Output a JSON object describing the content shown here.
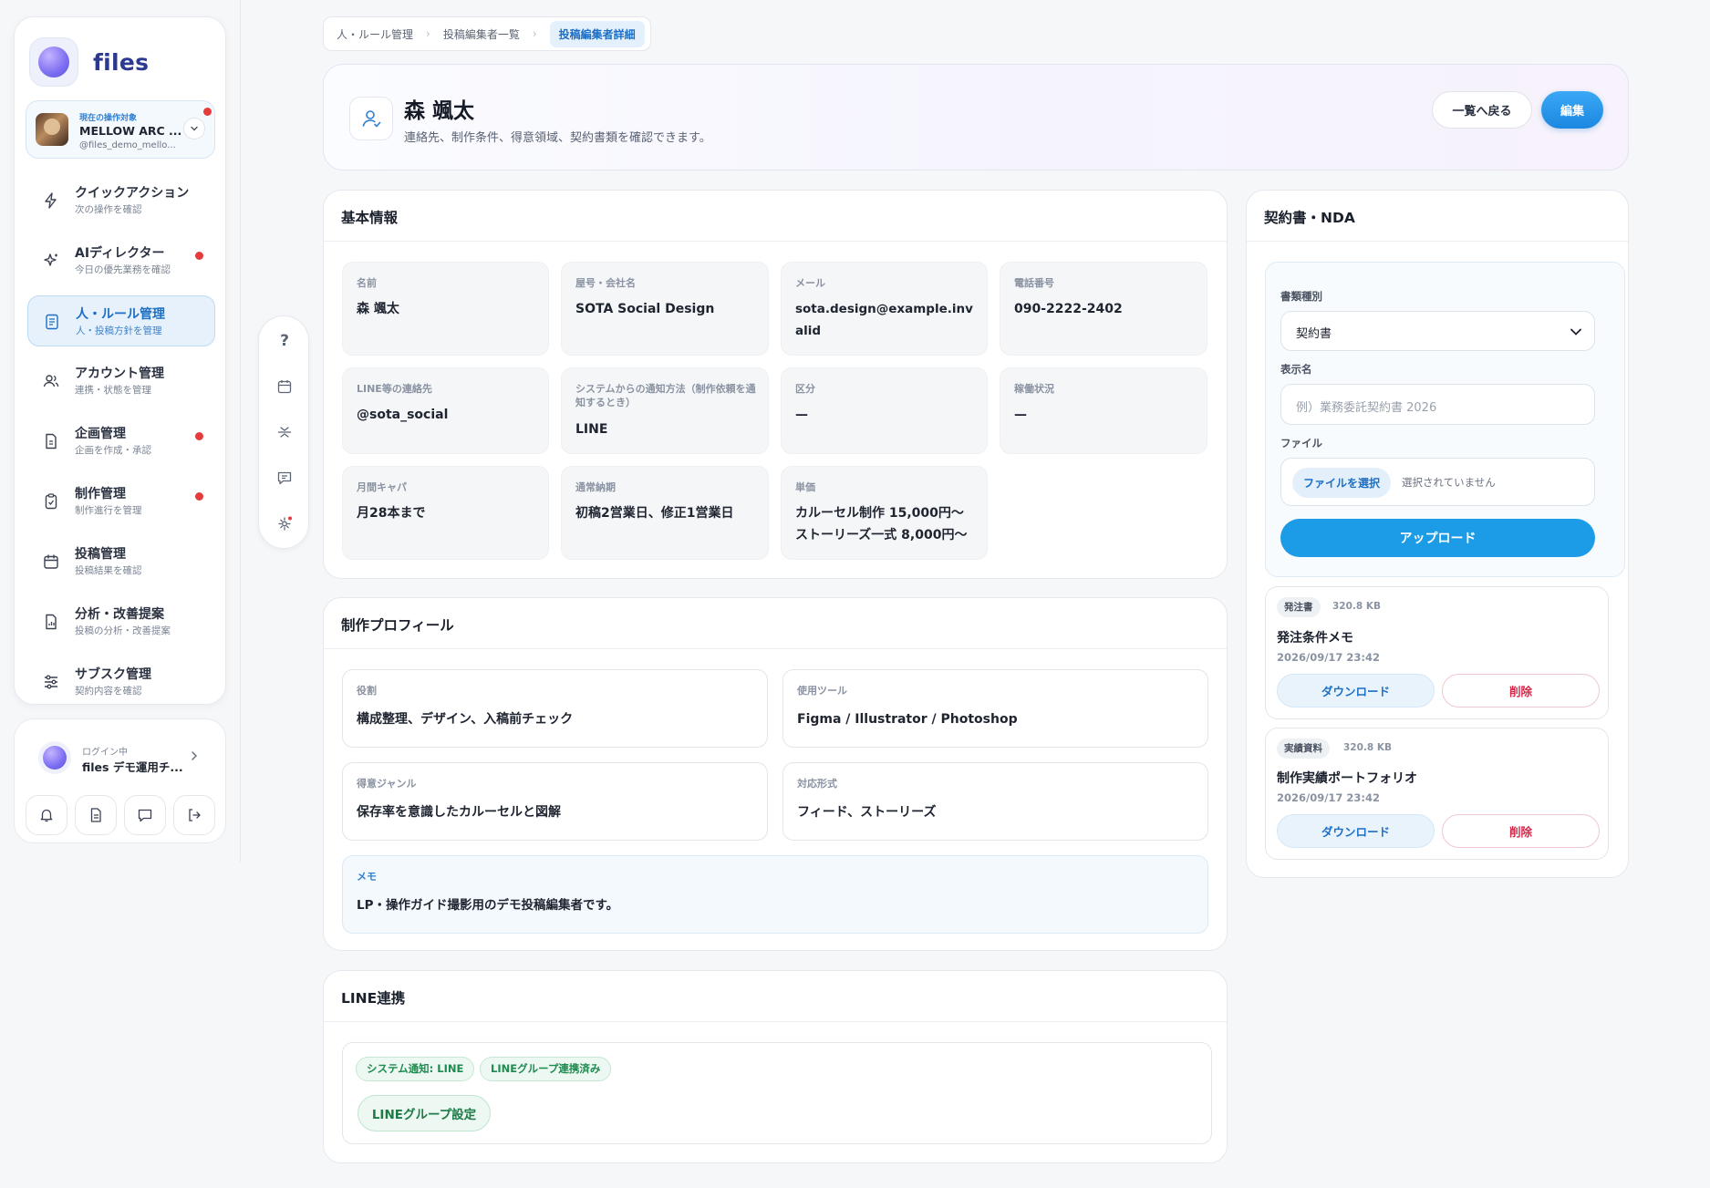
{
  "brand": {
    "name": "files"
  },
  "account": {
    "tag": "現在の操作対象",
    "name": "MELLOW ARC ...",
    "handle": "@files_demo_mello..."
  },
  "nav": [
    {
      "label": "クイックアクション",
      "sub": "次の操作を確認",
      "icon": "lightning-icon",
      "dot": false
    },
    {
      "label": "AIディレクター",
      "sub": "今日の優先業務を確認",
      "icon": "sparkle-icon",
      "dot": true
    },
    {
      "label": "人・ルール管理",
      "sub": "人・投稿方針を管理",
      "icon": "document-list-icon",
      "dot": false,
      "active": true
    },
    {
      "label": "アカウント管理",
      "sub": "連携・状態を管理",
      "icon": "users-icon",
      "dot": false
    },
    {
      "label": "企画管理",
      "sub": "企画を作成・承認",
      "icon": "file-icon",
      "dot": true
    },
    {
      "label": "制作管理",
      "sub": "制作進行を管理",
      "icon": "clipboard-icon",
      "dot": true
    },
    {
      "label": "投稿管理",
      "sub": "投稿結果を確認",
      "icon": "calendar-icon",
      "dot": false
    },
    {
      "label": "分析・改善提案",
      "sub": "投稿の分析・改善提案",
      "icon": "chart-file-icon",
      "dot": false
    },
    {
      "label": "サブスク管理",
      "sub": "契約内容を確認",
      "icon": "sliders-icon",
      "dot": false
    }
  ],
  "login": {
    "tag": "ログイン中",
    "name": "files デモ運用チ..."
  },
  "breadcrumb": [
    "人・ルール管理",
    "投稿編集者一覧",
    "投稿編集者詳細"
  ],
  "header": {
    "title": "森 颯太",
    "subtitle": "連絡先、制作条件、得意領域、契約書類を確認できます。",
    "back_label": "一覧へ戻る",
    "edit_label": "編集"
  },
  "basic": {
    "title": "基本情報",
    "fields": [
      {
        "label": "名前",
        "value": "森 颯太"
      },
      {
        "label": "屋号・会社名",
        "value": "SOTA Social Design"
      },
      {
        "label": "メール",
        "value": "sota.design@example.invalid"
      },
      {
        "label": "電話番号",
        "value": "090-2222-2402"
      },
      {
        "label": "LINE等の連絡先",
        "value": "@sota_social"
      },
      {
        "label": "システムからの通知方法（制作依頼を通知するとき）",
        "value": "LINE"
      },
      {
        "label": "区分",
        "value": "—"
      },
      {
        "label": "稼働状況",
        "value": "—"
      },
      {
        "label": "月間キャパ",
        "value": "月28本まで"
      },
      {
        "label": "通常納期",
        "value": "初稿2営業日、修正1営業日"
      },
      {
        "label": "単価",
        "value": "カルーセル制作 15,000円〜 ストーリーズ一式 8,000円〜"
      }
    ]
  },
  "profile": {
    "title": "制作プロフィール",
    "fields": [
      {
        "label": "役割",
        "value": "構成整理、デザイン、入稿前チェック"
      },
      {
        "label": "使用ツール",
        "value": "Figma / Illustrator / Photoshop"
      },
      {
        "label": "得意ジャンル",
        "value": "保存率を意識したカルーセルと図解"
      },
      {
        "label": "対応形式",
        "value": "フィード、ストーリーズ"
      }
    ],
    "memo": {
      "label": "メモ",
      "value": "LP・操作ガイド撮影用のデモ投稿編集者です。"
    }
  },
  "line": {
    "title": "LINE連携",
    "chips": [
      "システム通知: LINE",
      "LINEグループ連携済み"
    ],
    "button": "LINEグループ設定"
  },
  "contract": {
    "title": "契約書・NDA",
    "type_label": "書類種別",
    "type_value": "契約書",
    "name_label": "表示名",
    "name_placeholder": "例）業務委託契約書 2026",
    "file_label": "ファイル",
    "file_button": "ファイルを選択",
    "file_status": "選択されていません",
    "upload": "アップロード",
    "docs": [
      {
        "badge": "発注書",
        "size": "320.8 KB",
        "name": "発注条件メモ",
        "date": "2026/09/17 23:42",
        "download": "ダウンロード",
        "delete": "削除"
      },
      {
        "badge": "実績資料",
        "size": "320.8 KB",
        "name": "制作実績ポートフォリオ",
        "date": "2026/09/17 23:42",
        "download": "ダウンロード",
        "delete": "削除"
      }
    ]
  },
  "colors": {
    "accent": "#1c9be6",
    "active_nav": "#1c6fc4",
    "line_green": "#1e8a4f",
    "danger": "#d3284a",
    "badge_dot": "#e53b3b"
  }
}
